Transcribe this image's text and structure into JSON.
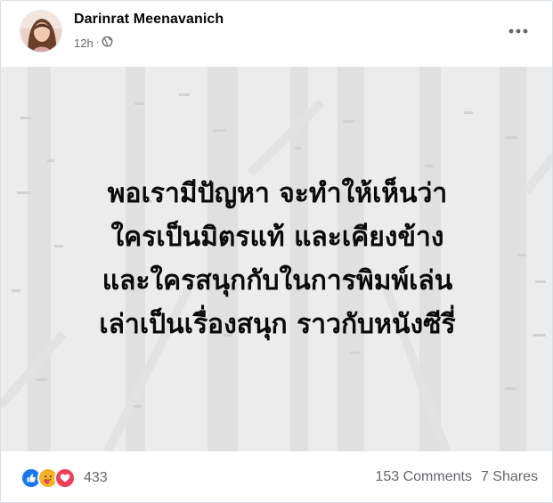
{
  "post": {
    "author": "Darinrat Meenavanich",
    "time": "12h",
    "privacy_icon": "globe-icon",
    "more_icon": "more-horizontal-icon",
    "text_lines": [
      "พอเรามีปัญหา จะทำให้เห็นว่า",
      "ใครเป็นมิตรแท้ และเคียงข้าง",
      "และใครสนุกกับในการพิมพ์เล่น",
      "เล่าเป็นเรื่องสนุก ราวกับหนังซีรี่"
    ]
  },
  "footer": {
    "reaction_icons": [
      "like-icon",
      "care-icon",
      "love-icon"
    ],
    "reaction_count": "433",
    "comments": "153 Comments",
    "shares": "7 Shares"
  },
  "colors": {
    "like": "#1877f2",
    "care": "#f7b125",
    "love": "#f33e58",
    "secondary_text": "#65676b"
  }
}
